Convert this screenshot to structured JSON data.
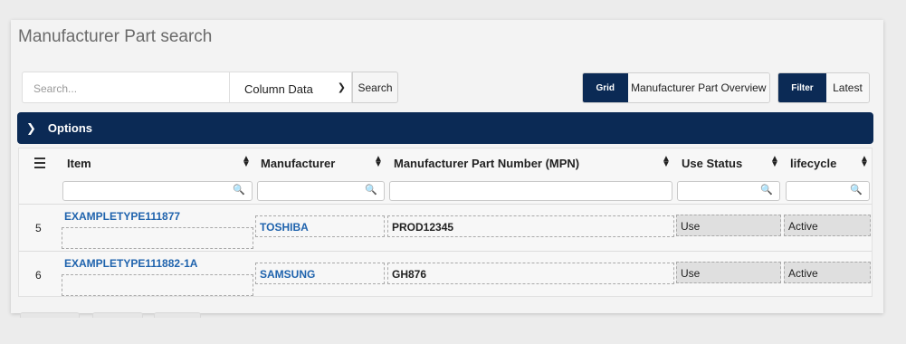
{
  "page": {
    "title": "Manufacturer Part search"
  },
  "search": {
    "placeholder": "Search...",
    "column_select": "Column Data",
    "button": "Search"
  },
  "view_toggle": {
    "grid": "Grid",
    "overview": "Manufacturer Part Overview"
  },
  "filter_toggle": {
    "filter": "Filter",
    "latest": "Latest"
  },
  "options": {
    "label": "Options"
  },
  "grid": {
    "columns": [
      "Item",
      "Manufacturer",
      "Manufacturer Part Number (MPN)",
      "Use Status",
      "lifecycle"
    ],
    "rows": [
      {
        "num": "5",
        "item": "EXAMPLETYPE111877",
        "manufacturer": "TOSHIBA",
        "mpn": "PROD12345",
        "use_status": "Use",
        "lifecycle": "Active"
      },
      {
        "num": "6",
        "item": "EXAMPLETYPE111882-1A",
        "manufacturer": "SAMSUNG",
        "mpn": "GH876",
        "use_status": "Use",
        "lifecycle": "Active"
      }
    ]
  },
  "colors": {
    "navy": "#0b2a55",
    "link": "#1f63ad"
  }
}
